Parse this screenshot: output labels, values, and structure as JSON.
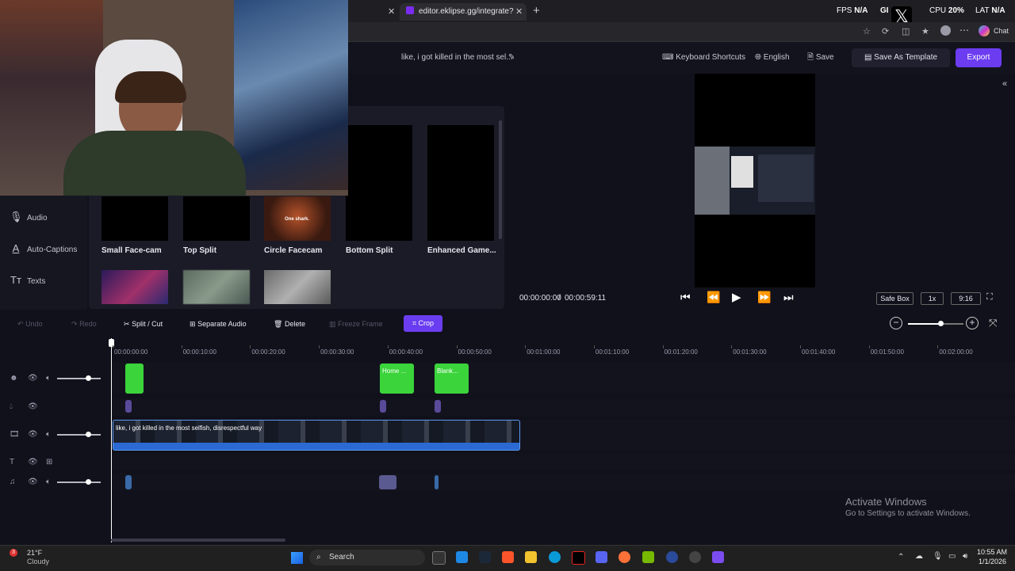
{
  "browser": {
    "tabs": [
      {
        "title": "editor.eklipse.gg/integrate?integr..."
      }
    ],
    "new_tab_symbol": "+",
    "close_symbol": "✕",
    "chat_label": "Chat"
  },
  "overlay_hud": {
    "fps_label": "FPS",
    "fps_value": "N/A",
    "gpu_label": "GI",
    "cpu_label": "CPU",
    "cpu_value": "20%",
    "lat_label": "LAT",
    "lat_value": "N/A"
  },
  "header": {
    "project_title": "like, i got killed in the most sel...",
    "keyboard_shortcuts": "Keyboard Shortcuts",
    "language": "English",
    "save": "Save",
    "save_as_template": "Save As Template",
    "export": "Export"
  },
  "sidebar": {
    "items": [
      {
        "label": "Audio",
        "icon": "microphone-icon"
      },
      {
        "label": "Auto-Captions",
        "icon": "caption-icon"
      },
      {
        "label": "Texts",
        "icon": "text-icon"
      }
    ]
  },
  "layouts": {
    "row1": [
      {
        "label": "Small Face-cam"
      },
      {
        "label": "Top Split"
      },
      {
        "label": "Circle Facecam",
        "thumb_text": "One shark."
      },
      {
        "label": "Bottom Split"
      },
      {
        "label": "Enhanced Game..."
      }
    ]
  },
  "preview": {
    "current_time": "00:00:00:00",
    "separator": "/",
    "duration": "00:00:59:11",
    "safe_box": "Safe Box",
    "speed": "1x",
    "aspect": "9:16"
  },
  "toolbar": {
    "undo": "Undo",
    "redo": "Redo",
    "split_cut": "Split / Cut",
    "separate_audio": "Separate Audio",
    "delete": "Delete",
    "freeze_frame": "Freeze Frame",
    "crop": "Crop",
    "zoom_level": 0.58
  },
  "timeline": {
    "ruler": [
      "00:00:00:00",
      "00:00:10:00",
      "00:00:20:00",
      "00:00:30:00",
      "00:00:40:00",
      "00:00:50:00",
      "00:01:00:00",
      "00:01:10:00",
      "00:01:20:00",
      "00:01:30:00",
      "00:01:40:00",
      "00:01:50:00",
      "00:02:00:00"
    ],
    "overlay_clips": [
      "Home ...",
      "Blank..."
    ],
    "main_clip_caption": "like, i got killed in the most selfish, disrespectful way",
    "volumes": {
      "track1": 0.7,
      "track3": 0.7,
      "track5": 0.7
    }
  },
  "watermark": {
    "title": "Activate Windows",
    "subtitle": "Go to Settings to activate Windows."
  },
  "taskbar": {
    "weather_temp": "21°F",
    "weather_desc": "Cloudy",
    "weather_badge": "3",
    "search_placeholder": "Search",
    "time": "10:55 AM",
    "date": "1/1/2026"
  },
  "colors": {
    "accent": "#6b3cf0",
    "clip_green": "#3bd43b",
    "main_clip": "#2a6ad2"
  }
}
